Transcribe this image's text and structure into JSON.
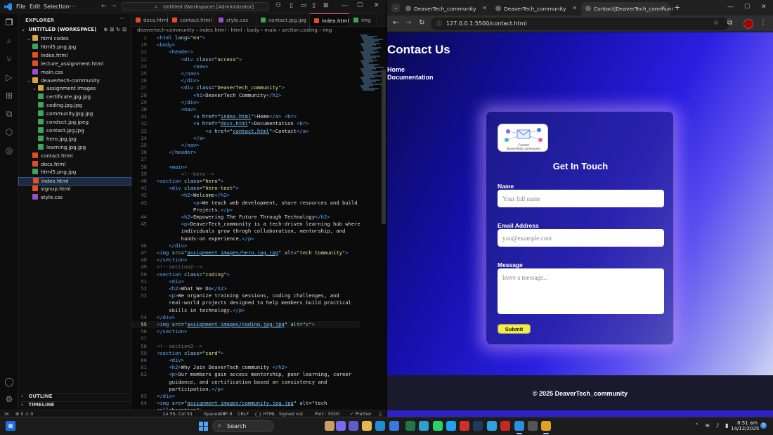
{
  "vscode": {
    "menu": [
      "File",
      "Edit",
      "Selection"
    ],
    "search_text": "Untitled (Workspace) [Administrator]",
    "explorer_title": "EXPLORER",
    "workspace_label": "UNTITLED (WORKSPACE)",
    "tree": [
      {
        "label": "html codes",
        "type": "folder",
        "depth": 1
      },
      {
        "label": "html5.png.jpg",
        "type": "img",
        "depth": 2
      },
      {
        "label": "index.html",
        "type": "html",
        "depth": 2
      },
      {
        "label": "lecture_assignment.html",
        "type": "html",
        "depth": 2
      },
      {
        "label": "main.css",
        "type": "css",
        "depth": 2
      },
      {
        "label": "deavertech-community",
        "type": "folder",
        "depth": 1
      },
      {
        "label": "assignment images",
        "type": "folder",
        "depth": 2
      },
      {
        "label": "certificate.jpg.jpg",
        "type": "img",
        "depth": 3
      },
      {
        "label": "coding.jpg.jpg",
        "type": "img",
        "depth": 3
      },
      {
        "label": "community.jpg.jpg",
        "type": "img",
        "depth": 3
      },
      {
        "label": "conduct.jpg.jpeg",
        "type": "img",
        "depth": 3
      },
      {
        "label": "contact.jpg.jpg",
        "type": "img",
        "depth": 3
      },
      {
        "label": "hero.jpg.jpg",
        "type": "img",
        "depth": 3
      },
      {
        "label": "learning.jpg.jpg",
        "type": "img",
        "depth": 3
      },
      {
        "label": "contact.html",
        "type": "html",
        "depth": 2
      },
      {
        "label": "docs.html",
        "type": "html",
        "depth": 2
      },
      {
        "label": "html5.png.jpg",
        "type": "img",
        "depth": 2
      },
      {
        "label": "index.html",
        "type": "html",
        "depth": 2,
        "selected": true
      },
      {
        "label": "signup.html",
        "type": "html",
        "depth": 2
      },
      {
        "label": "style.css",
        "type": "css",
        "depth": 2
      }
    ],
    "outline_label": "OUTLINE",
    "timeline_label": "TIMELINE",
    "tabs": [
      {
        "label": "docs.html",
        "type": "html"
      },
      {
        "label": "contact.html",
        "type": "html"
      },
      {
        "label": "style.css",
        "type": "css"
      },
      {
        "label": "contact.jpg.jpg",
        "type": "img"
      },
      {
        "label": "index.html",
        "type": "html",
        "active": true
      },
      {
        "label": "img",
        "type": "img"
      }
    ],
    "breadcrumbs": "deavertech-community  ›  index.html  ›  html  ›  body  ›  main  ›  section.coding  ›  img",
    "code_lines": [
      {
        "n": "2",
        "t": "<html lang=\"en\">"
      },
      {
        "n": "19",
        "t": "<body>"
      },
      {
        "n": "21",
        "t": "    <header>"
      },
      {
        "n": "22",
        "t": "        <div class=\"access\">"
      },
      {
        "n": "23",
        "t": "            <nav>"
      },
      {
        "n": "25",
        "t": "        </nav>"
      },
      {
        "n": "26",
        "t": "        </div>"
      },
      {
        "n": "27",
        "t": "        <div class=\"DeaverTech_community\">"
      },
      {
        "n": "28",
        "t": "            <h1>DeaverTech Community</h1>"
      },
      {
        "n": "29",
        "t": "        </div>"
      },
      {
        "n": "30",
        "t": "        <nav>"
      },
      {
        "n": "31",
        "t": "            <a href=\"index.html\">Home</a> <br>"
      },
      {
        "n": "32",
        "t": "            <a href=\"docs.html\">Documentation <br>"
      },
      {
        "n": "33",
        "t": "                <a href=\"contact.html\">Contact</a>"
      },
      {
        "n": "34",
        "t": "            </a>"
      },
      {
        "n": "35",
        "t": "        </nav>"
      },
      {
        "n": "36",
        "t": "    </header>"
      },
      {
        "n": "37",
        "t": ""
      },
      {
        "n": "38",
        "t": "    <main>"
      },
      {
        "n": "39",
        "t": "        <!--hero-->"
      },
      {
        "n": "40",
        "t": "<section class=\"hero\">"
      },
      {
        "n": "41",
        "t": "    <div class=\"hero-text\">"
      },
      {
        "n": "42",
        "t": "        <h2>Welcome</h2>"
      },
      {
        "n": "43",
        "t": "            <p>We teach web development, share resources and build"
      },
      {
        "n": "",
        "t": "            Projects.</p>"
      },
      {
        "n": "44",
        "t": "        <h2>Empowering The Future Through Technology</h2>"
      },
      {
        "n": "45",
        "t": "        <p>DeaverTech_community is a tech-driven learning hub where"
      },
      {
        "n": "",
        "t": "        individuals grow throgh collaboration, mentorship, and"
      },
      {
        "n": "",
        "t": "        hands-on experience.</p>"
      },
      {
        "n": "46",
        "t": "    </div>"
      },
      {
        "n": "47",
        "t": "<img src=\"assignment images/hero.jpg.jpg\" alt=\"tech Community\">"
      },
      {
        "n": "48",
        "t": "</section>"
      },
      {
        "n": "49",
        "t": "<!--section2-->"
      },
      {
        "n": "50",
        "t": "<section class=\"coding\">"
      },
      {
        "n": "51",
        "t": "    <div>"
      },
      {
        "n": "52",
        "t": "    <h2>What We Do</h2>"
      },
      {
        "n": "53",
        "t": "    <p>We organize training sessions, coding challenges, and"
      },
      {
        "n": "",
        "t": "    real-world projects designed to help members build practical"
      },
      {
        "n": "",
        "t": "    skills in technology.</p>"
      },
      {
        "n": "54",
        "t": "</div>"
      },
      {
        "n": "55",
        "t": "<img src=\"assignment images/coding.jpg.jpg\" alt=\"c\">",
        "current": true
      },
      {
        "n": "56",
        "t": "</section>"
      },
      {
        "n": "57",
        "t": ""
      },
      {
        "n": "58",
        "t": "<!--section3-->"
      },
      {
        "n": "59",
        "t": "<section class=\"card\">"
      },
      {
        "n": "60",
        "t": "    <div>"
      },
      {
        "n": "61",
        "t": "    <h2>Why Join DeaverTech_community </h2>"
      },
      {
        "n": "62",
        "t": "    <p>Our members gain access mentorship, peer learning, career"
      },
      {
        "n": "",
        "t": "    guidance, and certification based on consistency and"
      },
      {
        "n": "",
        "t": "    participation.</p>"
      },
      {
        "n": "63",
        "t": "</div>"
      },
      {
        "n": "64",
        "t": "<img src=\"assignment images/community.jpg.jpg\" alt=\"tech"
      },
      {
        "n": "",
        "t": "collaboration\">"
      }
    ],
    "status": {
      "errors": "⊗ 0 ⚠ 0",
      "position": "Ln 55, Col 51",
      "spaces": "Spaces: 4",
      "encoding": "UTF-8",
      "eol": "CRLF",
      "language": "{ } HTML",
      "signed": "Signed out",
      "port": "Port : 5500",
      "prettier": "✓ Prettier"
    }
  },
  "browser": {
    "tabs": [
      {
        "label": "DeaverTech_community"
      },
      {
        "label": "DeaverTech_community"
      },
      {
        "label": "Contact|DeaverTech_communi",
        "active": true
      }
    ],
    "url": "127.0.0.1:5500/contact.html",
    "page": {
      "title": "Contact Us",
      "nav": [
        "Home",
        "Documentation"
      ],
      "logo_text_1": "Contact",
      "logo_text_2": "DeaverTech_community",
      "heading": "Get In Touch",
      "name_label": "Name",
      "name_placeholder": "Your full name",
      "email_label": "Email Address",
      "email_placeholder": "you@example.com",
      "message_label": "Message",
      "message_placeholder": "leave a message...",
      "submit_label": "Submit",
      "footer": "© 2025 DeaverTech_community"
    }
  },
  "taskbar": {
    "search_label": "Search",
    "time": "8:51 am",
    "date": "14/12/2025"
  }
}
